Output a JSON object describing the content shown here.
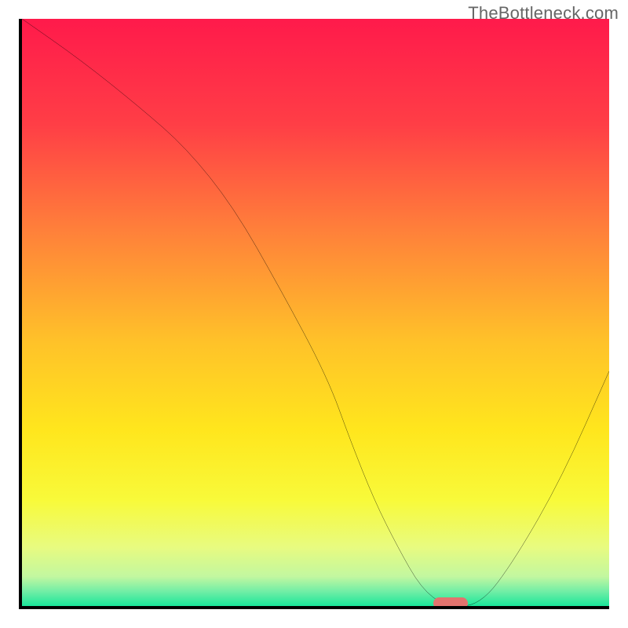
{
  "watermark": "TheBottleneck.com",
  "colors": {
    "axis": "#000000",
    "curve": "#000000",
    "optimal_marker": "#e2736e",
    "gradient_stops": [
      {
        "pos": 0.0,
        "color": "#ff1a4b"
      },
      {
        "pos": 0.18,
        "color": "#ff3e46"
      },
      {
        "pos": 0.36,
        "color": "#ff803a"
      },
      {
        "pos": 0.55,
        "color": "#ffc229"
      },
      {
        "pos": 0.7,
        "color": "#ffe61d"
      },
      {
        "pos": 0.82,
        "color": "#f8fa3a"
      },
      {
        "pos": 0.9,
        "color": "#e8fb80"
      },
      {
        "pos": 0.95,
        "color": "#c2f7a0"
      },
      {
        "pos": 0.975,
        "color": "#72eea6"
      },
      {
        "pos": 1.0,
        "color": "#1ae69a"
      }
    ]
  },
  "chart_data": {
    "type": "line",
    "title": "",
    "xlabel": "",
    "ylabel": "",
    "xlim": [
      0,
      100
    ],
    "ylim": [
      0,
      100
    ],
    "x": [
      0,
      10,
      20,
      28,
      36,
      44,
      52,
      56,
      60,
      64,
      68,
      72,
      78,
      84,
      92,
      100
    ],
    "values": [
      100,
      93,
      85,
      78,
      68,
      54,
      39,
      28,
      18,
      10,
      3,
      0,
      0,
      8,
      22,
      40
    ],
    "optimal_range_x": [
      68,
      76
    ],
    "optimal_marker": {
      "x_start": 70,
      "x_end": 76,
      "y": 0.5,
      "height": 2.0
    }
  }
}
